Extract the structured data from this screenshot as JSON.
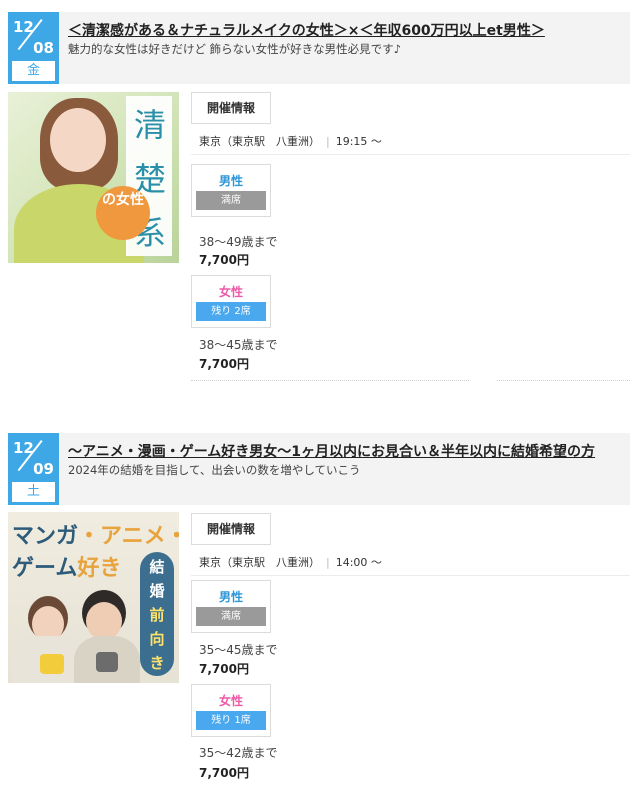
{
  "events": [
    {
      "month": "12",
      "day": "08",
      "weekday": "金",
      "title": "＜清潔感がある＆ナチュラルメイクの女性＞×＜年収600万円以上et男性＞",
      "subtitle": "魅力的な女性は好きだけど 飾らない女性が好きな男性必見です♪",
      "image_text": {
        "k1": "清",
        "k2": "楚",
        "k3": "系",
        "circle": "の女性"
      },
      "info_label": "開催情報",
      "venue": "東京（東京駅　八重洲）",
      "time": "19:15 ～",
      "male": {
        "label": "男性",
        "status": "満席",
        "age": "38～49歳まで",
        "price": "7,700円"
      },
      "female": {
        "label": "女性",
        "status": "残り 2席",
        "age": "38～45歳まで",
        "price": "7,700円"
      }
    },
    {
      "month": "12",
      "day": "09",
      "weekday": "土",
      "title": "～アニメ・漫画・ゲーム好き男女～1ヶ月以内にお見合い＆半年以内に結婚希望の方",
      "subtitle": "2024年の結婚を目指して、出会いの数を増やしていこう",
      "image_text": {
        "line1a": "マンガ",
        "line1b": "・アニメ・",
        "line2a": "ゲーム",
        "line2b": "好き",
        "pill": [
          "結",
          "婚",
          "前",
          "向",
          "き"
        ]
      },
      "info_label": "開催情報",
      "venue": "東京（東京駅　八重洲）",
      "time": "14:00 ～",
      "male": {
        "label": "男性",
        "status": "満席",
        "age": "35～45歳まで",
        "price": "7,700円"
      },
      "female": {
        "label": "女性",
        "status": "残り 1席",
        "age": "35～42歳まで",
        "price": "7,700円"
      }
    }
  ],
  "colors": {
    "accent": "#3ea8e6",
    "male": "#2f97d8",
    "female": "#ee5aa8",
    "full": "#9a9a9a",
    "seats_left": "#4aa8ee"
  },
  "icons": {
    "separator": "pipe"
  }
}
